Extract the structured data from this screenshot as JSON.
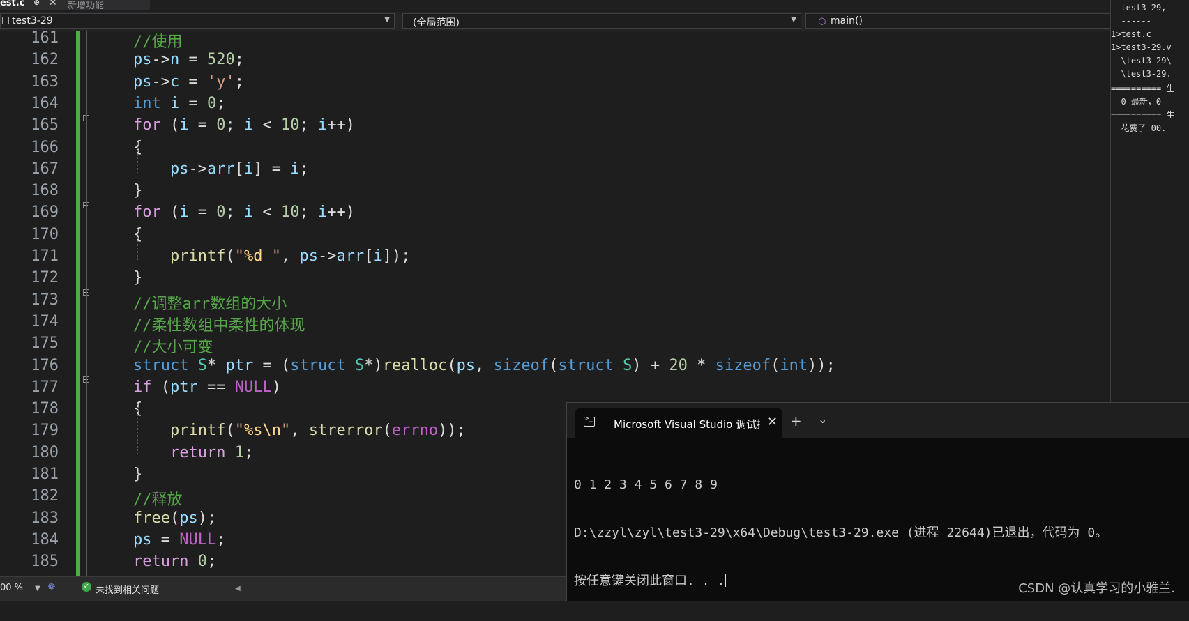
{
  "tabs": {
    "active_label": "est.c",
    "pin": "⊕",
    "close": "✕",
    "second_label": "新增功能"
  },
  "navbar": {
    "project": "test3-29",
    "scope": "(全局范围)",
    "function": "main()"
  },
  "editor": {
    "lines": [
      {
        "n": "161",
        "html": "<span class=\"cm\">//使用</span>"
      },
      {
        "n": "162",
        "html": "<span class=\"vr\">ps</span>-&gt;<span class=\"vr\">n</span> = <span class=\"nm\">520</span>;"
      },
      {
        "n": "163",
        "html": "<span class=\"vr\">ps</span>-&gt;<span class=\"vr\">c</span> = <span class=\"st\">'y'</span>;"
      },
      {
        "n": "164",
        "html": "<span class=\"kw\">int</span> <span class=\"vr\">i</span> = <span class=\"nm\">0</span>;"
      },
      {
        "n": "165",
        "html": "<span class=\"ctl\">for</span> (<span class=\"vr\">i</span> = <span class=\"nm\">0</span>; <span class=\"vr\">i</span> &lt; <span class=\"nm\">10</span>; <span class=\"vr\">i</span>++)"
      },
      {
        "n": "166",
        "html": "{"
      },
      {
        "n": "167",
        "html": "    <span class=\"vr\">ps</span>-&gt;<span class=\"vr\">arr</span>[<span class=\"vr\">i</span>] = <span class=\"vr\">i</span>;"
      },
      {
        "n": "168",
        "html": "}"
      },
      {
        "n": "169",
        "html": "<span class=\"ctl\">for</span> (<span class=\"vr\">i</span> = <span class=\"nm\">0</span>; <span class=\"vr\">i</span> &lt; <span class=\"nm\">10</span>; <span class=\"vr\">i</span>++)"
      },
      {
        "n": "170",
        "html": "{"
      },
      {
        "n": "171",
        "html": "    <span class=\"fn\">printf</span>(<span class=\"st\">\"</span><span class=\"esc\">%d</span><span class=\"st\"> \"</span>, <span class=\"vr\">ps</span>-&gt;<span class=\"vr\">arr</span>[<span class=\"vr\">i</span>]);"
      },
      {
        "n": "172",
        "html": "}"
      },
      {
        "n": "173",
        "html": "<span class=\"cm\">//调整arr数组的大小</span>"
      },
      {
        "n": "174",
        "html": "<span class=\"cm\">//柔性数组中柔性的体现</span>"
      },
      {
        "n": "175",
        "html": "<span class=\"cm\">//大小可变</span>"
      },
      {
        "n": "176",
        "html": "<span class=\"kw\">struct</span> <span class=\"ty\">S</span>* <span class=\"vr\">ptr</span> = (<span class=\"kw\">struct</span> <span class=\"ty\">S</span>*)<span class=\"fn\">realloc</span>(<span class=\"vr\">ps</span>, <span class=\"kw\">sizeof</span>(<span class=\"kw\">struct</span> <span class=\"ty\">S</span>) + <span class=\"nm\">20</span> * <span class=\"kw\">sizeof</span>(<span class=\"kw\">int</span>));"
      },
      {
        "n": "177",
        "html": "<span class=\"ctl\">if</span> (<span class=\"vr\">ptr</span> == <span class=\"mac\">NULL</span>)"
      },
      {
        "n": "178",
        "html": "{"
      },
      {
        "n": "179",
        "html": "    <span class=\"fn\">printf</span>(<span class=\"st\">\"</span><span class=\"esc\">%s\\n</span><span class=\"st\">\"</span>, <span class=\"fn\">strerror</span>(<span class=\"mac\">errno</span>));"
      },
      {
        "n": "180",
        "html": "    <span class=\"ctl\">return</span> <span class=\"nm\">1</span>;"
      },
      {
        "n": "181",
        "html": "}"
      },
      {
        "n": "182",
        "html": "<span class=\"cm\">//释放</span>"
      },
      {
        "n": "183",
        "html": "<span class=\"fn\">free</span>(<span class=\"vr\">ps</span>);"
      },
      {
        "n": "184",
        "html": "<span class=\"vr\">ps</span> = <span class=\"mac\">NULL</span>;"
      },
      {
        "n": "185",
        "html": "<span class=\"ctl\">return</span> <span class=\"nm\">0</span>;"
      }
    ]
  },
  "output_pane": {
    "lines": [
      "  test3-29, ",
      "  ------",
      "1>test.c",
      "1>test3-29.v",
      "  \\test3-29\\",
      "  \\test3-29.",
      "========== 生",
      "  0 最新，0 ",
      "========== 生",
      "  花费了 00."
    ]
  },
  "statusbar": {
    "zoom": "00 %",
    "issues": "未找到相关问题"
  },
  "terminal": {
    "tab_title": "Microsoft Visual Studio 调试控",
    "close": "✕",
    "plus": "+",
    "chevron": "⌄",
    "line1": "0 1 2 3 4 5 6 7 8 9",
    "line2": "D:\\zzyl\\zyl\\test3-29\\x64\\Debug\\test3-29.exe (进程 22644)已退出，代码为 0。",
    "line3": "按任意键关闭此窗口. . ."
  },
  "watermark": "CSDN @认真学习的小雅兰.",
  "colors": {
    "change_bar": "#56a64b",
    "keyword": "#569cd6",
    "comment": "#57a64a",
    "function": "#dcdcaa",
    "variable": "#9cdcfe"
  }
}
